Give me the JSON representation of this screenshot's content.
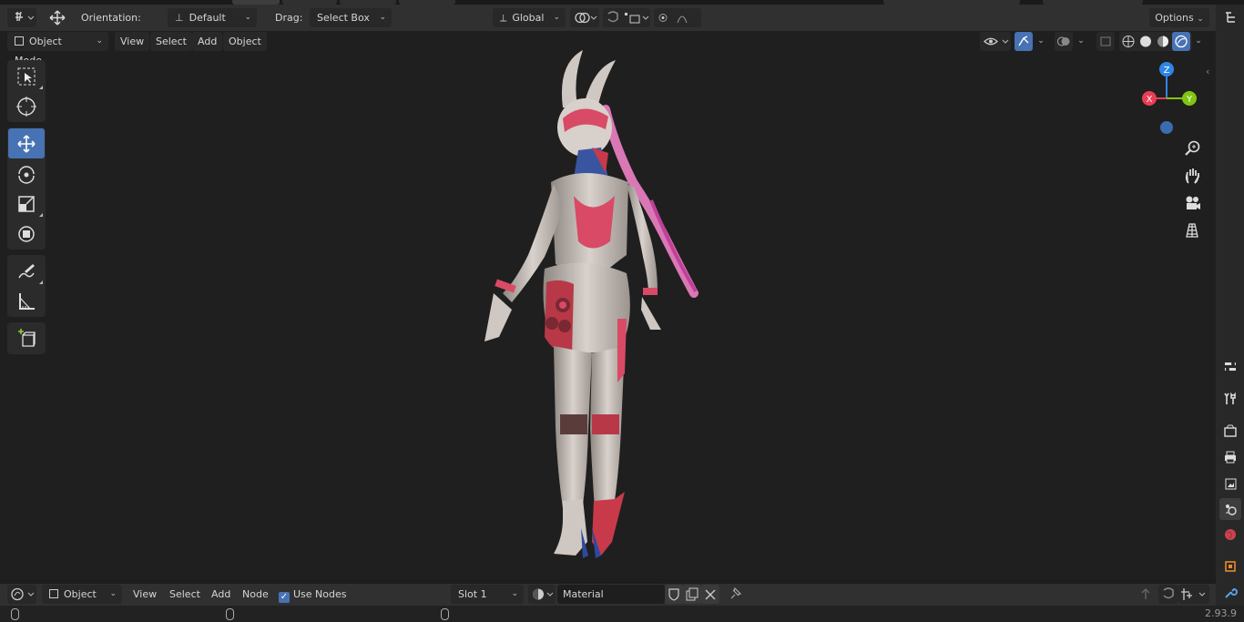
{
  "header": {
    "orientation_label": "Orientation:",
    "orientation_value": "Default",
    "drag_label": "Drag:",
    "drag_value": "Select Box",
    "transform_orientation": "Global",
    "options_label": "Options"
  },
  "viewport_header": {
    "mode": "Object Mode",
    "menus": [
      "View",
      "Select",
      "Add",
      "Object"
    ]
  },
  "tools": [
    "select-box",
    "cursor",
    "move",
    "rotate",
    "scale",
    "transform",
    "annotate",
    "measure",
    "add-cube"
  ],
  "active_tool": "move",
  "gizmo": {
    "z": "Z",
    "x": "X",
    "y": "Y"
  },
  "node_header": {
    "editor": "Object",
    "menus": [
      "View",
      "Select",
      "Add",
      "Node"
    ],
    "use_nodes_label": "Use Nodes",
    "use_nodes_checked": true,
    "slot": "Slot 1",
    "material": "Material"
  },
  "status": {
    "version": "2.93.9"
  },
  "colors": {
    "accent": "#4772b3",
    "axis_x": "#e83e56",
    "axis_y": "#82c412",
    "axis_z": "#2f85e8"
  }
}
